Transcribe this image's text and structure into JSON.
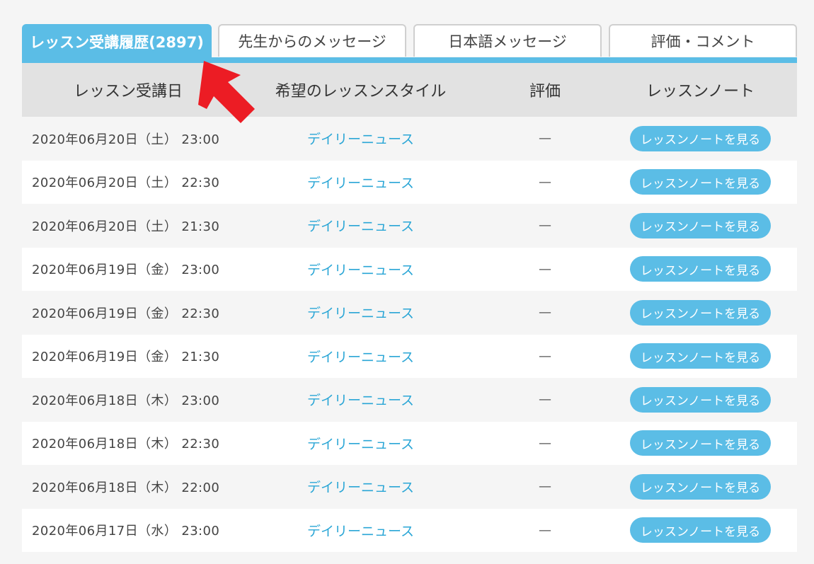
{
  "tabs": [
    {
      "label": "レッスン受講履歴(2897)",
      "active": true
    },
    {
      "label": "先生からのメッセージ",
      "active": false
    },
    {
      "label": "日本語メッセージ",
      "active": false
    },
    {
      "label": "評価・コメント",
      "active": false
    }
  ],
  "table": {
    "headers": {
      "date": "レッスン受講日",
      "style": "希望のレッスンスタイル",
      "rating": "評価",
      "note": "レッスンノート"
    },
    "rows": [
      {
        "date": "2020年06月20日（土） 23:00",
        "style": "デイリーニュース",
        "rating": "—",
        "note_button": "レッスンノートを見る"
      },
      {
        "date": "2020年06月20日（土） 22:30",
        "style": "デイリーニュース",
        "rating": "—",
        "note_button": "レッスンノートを見る"
      },
      {
        "date": "2020年06月20日（土） 21:30",
        "style": "デイリーニュース",
        "rating": "—",
        "note_button": "レッスンノートを見る"
      },
      {
        "date": "2020年06月19日（金） 23:00",
        "style": "デイリーニュース",
        "rating": "—",
        "note_button": "レッスンノートを見る"
      },
      {
        "date": "2020年06月19日（金） 22:30",
        "style": "デイリーニュース",
        "rating": "—",
        "note_button": "レッスンノートを見る"
      },
      {
        "date": "2020年06月19日（金） 21:30",
        "style": "デイリーニュース",
        "rating": "—",
        "note_button": "レッスンノートを見る"
      },
      {
        "date": "2020年06月18日（木） 23:00",
        "style": "デイリーニュース",
        "rating": "—",
        "note_button": "レッスンノートを見る"
      },
      {
        "date": "2020年06月18日（木） 22:30",
        "style": "デイリーニュース",
        "rating": "—",
        "note_button": "レッスンノートを見る"
      },
      {
        "date": "2020年06月18日（木） 22:00",
        "style": "デイリーニュース",
        "rating": "—",
        "note_button": "レッスンノートを見る"
      },
      {
        "date": "2020年06月17日（水） 23:00",
        "style": "デイリーニュース",
        "rating": "—",
        "note_button": "レッスンノートを見る"
      }
    ]
  },
  "colors": {
    "accent": "#5bbde6",
    "link": "#2aa6d6",
    "header_bg": "#e2e2e2",
    "annotation_arrow": "#ec1c24"
  },
  "annotation": {
    "icon": "red-arrow-icon"
  }
}
